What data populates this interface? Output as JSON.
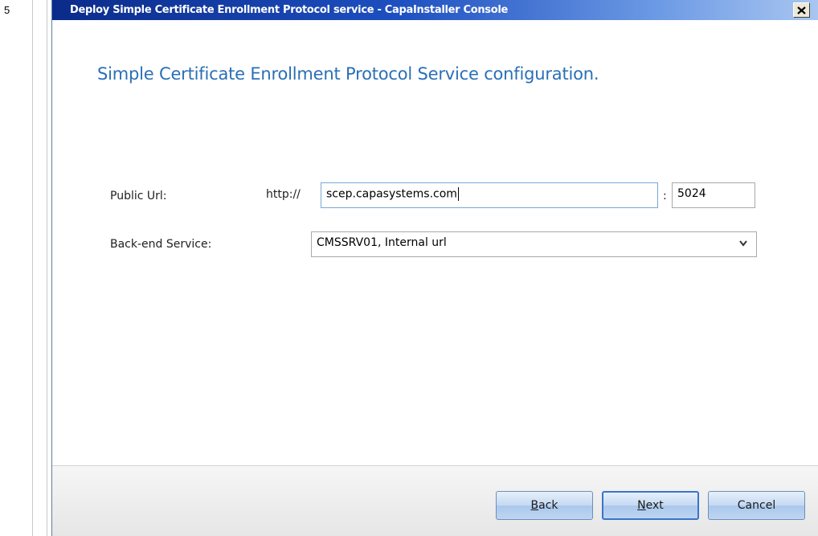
{
  "step": "5",
  "window": {
    "title": "Deploy Simple Certificate Enrollment Protocol service - CapaInstaller Console",
    "close_icon": "close-icon"
  },
  "heading": "Simple Certificate Enrollment Protocol Service configuration.",
  "form": {
    "public_url": {
      "label": "Public Url:",
      "prefix": "http://",
      "value": "scep.capasystems.com",
      "port_separator": ":",
      "port": "5024"
    },
    "backend_service": {
      "label": "Back-end Service:",
      "selected": "CMSSRV01, Internal url",
      "icon": "chevron-down-icon"
    }
  },
  "buttons": {
    "back": {
      "accel": "B",
      "rest": "ack"
    },
    "next": {
      "accel": "N",
      "rest": "ext"
    },
    "cancel": "Cancel"
  },
  "colors": {
    "title_bar": "#1d4fc0",
    "heading": "#2a6fb6",
    "button": "#c4d9f2"
  }
}
